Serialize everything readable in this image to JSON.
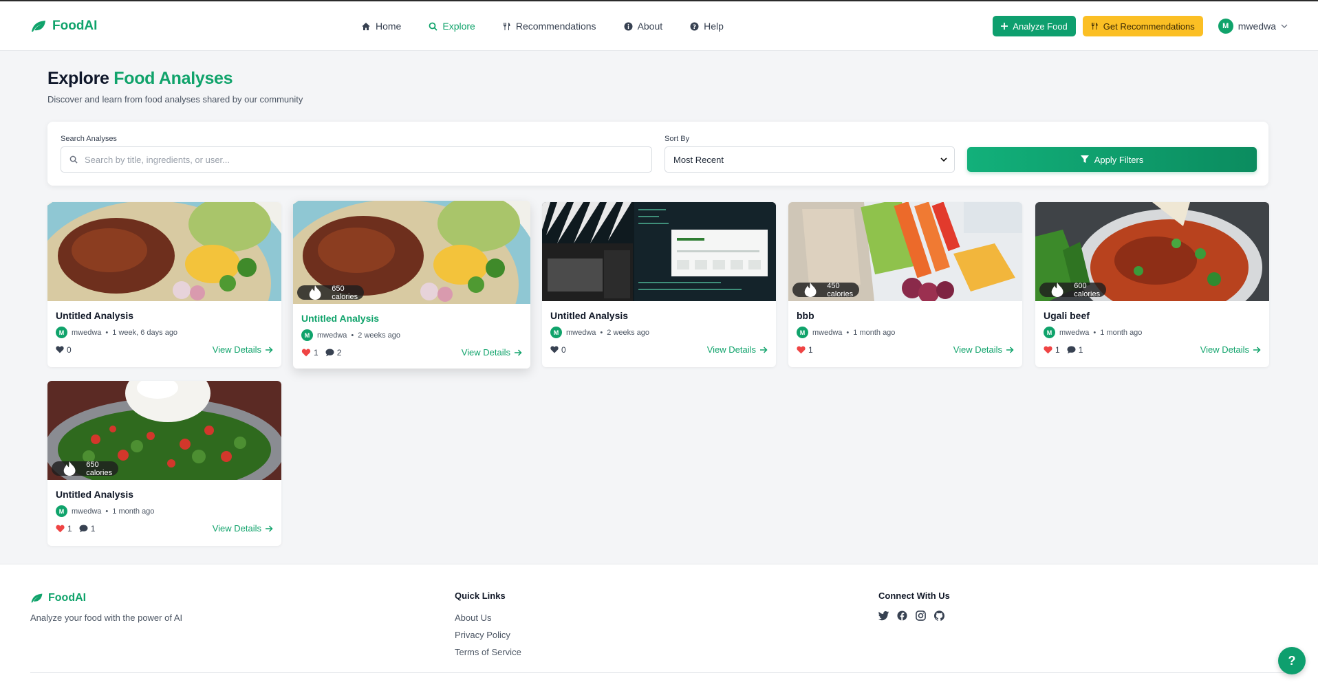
{
  "brand": {
    "name": "FoodAI"
  },
  "nav": {
    "links": [
      {
        "label": "Home",
        "icon": "home-icon"
      },
      {
        "label": "Explore",
        "icon": "search-icon",
        "active": true
      },
      {
        "label": "Recommendations",
        "icon": "utensils-icon"
      },
      {
        "label": "About",
        "icon": "info-icon"
      },
      {
        "label": "Help",
        "icon": "question-icon"
      }
    ],
    "analyze_label": "Analyze Food",
    "recommend_label": "Get Recommendations",
    "user": {
      "initial": "M",
      "name": "mwedwa"
    }
  },
  "header": {
    "title_plain": "Explore",
    "title_accent": "Food Analyses",
    "subtitle": "Discover and learn from food analyses shared by our community"
  },
  "filters": {
    "search_label": "Search Analyses",
    "search_placeholder": "Search by title, ingredients, or user...",
    "sort_label": "Sort By",
    "sort_value": "Most Recent",
    "apply_label": "Apply Filters"
  },
  "cards": [
    {
      "title": "Untitled Analysis",
      "user": "mwedwa",
      "initial": "M",
      "time": "1 week, 6 days ago",
      "calories": "",
      "likes": "0",
      "liked": false,
      "comments": "",
      "view": "View Details",
      "image": "bowl-image"
    },
    {
      "title": "Untitled Analysis",
      "user": "mwedwa",
      "initial": "M",
      "time": "2 weeks ago",
      "calories": "650 calories",
      "likes": "1",
      "liked": true,
      "comments": "2",
      "view": "View Details",
      "image": "bowl-image"
    },
    {
      "title": "Untitled Analysis",
      "user": "mwedwa",
      "initial": "M",
      "time": "2 weeks ago",
      "calories": "",
      "likes": "0",
      "liked": false,
      "comments": "",
      "view": "View Details",
      "image": "screenshot-image"
    },
    {
      "title": "bbb",
      "user": "mwedwa",
      "initial": "M",
      "time": "1 month ago",
      "calories": "450 calories",
      "likes": "1",
      "liked": true,
      "comments": "",
      "view": "View Details",
      "image": "snack-box-image"
    },
    {
      "title": "Ugali beef",
      "user": "mwedwa",
      "initial": "M",
      "time": "1 month ago",
      "calories": "600 calories",
      "likes": "1",
      "liked": true,
      "comments": "1",
      "view": "View Details",
      "image": "stew-image"
    },
    {
      "title": "Untitled Analysis",
      "user": "mwedwa",
      "initial": "M",
      "time": "1 month ago",
      "calories": "650 calories",
      "likes": "1",
      "liked": true,
      "comments": "1",
      "view": "View Details",
      "image": "ugali-greens-image"
    }
  ],
  "footer": {
    "brand": "FoodAI",
    "tagline": "Analyze your food with the power of AI",
    "quick_links_title": "Quick Links",
    "quick_links": [
      "About Us",
      "Privacy Policy",
      "Terms of Service"
    ],
    "connect_title": "Connect With Us",
    "socials": [
      "twitter-icon",
      "facebook-icon",
      "instagram-icon",
      "github-icon"
    ]
  },
  "help_fab": "?",
  "colors": {
    "accent": "#10a36b",
    "warning": "#fbbf24",
    "like": "#ef4444"
  }
}
